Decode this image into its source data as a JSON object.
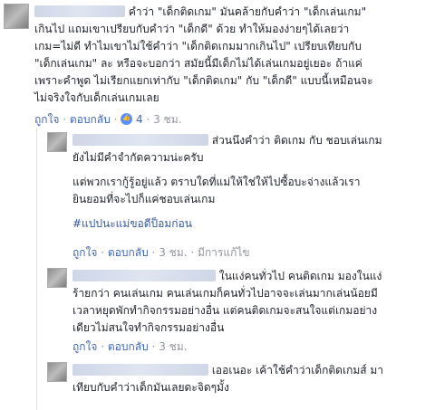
{
  "comment1": {
    "lines": [
      "คำว่า \"เด็กติดเกม\" มันคล้ายกับคำว่า \"เด็กเล่นเกม\"",
      "เกินไป แถมเขาเปรียบกับคำว่า \"เด็กดี\" ด้วย ทำให้มองง่ายๆได้เลยว่า",
      "เกม=ไม่ดี ทำไมเขาไม่ใช้คำว่า \"เด็กติดเกมมากเกินไป\" เปรียบเทียบกับ",
      "\"เด็กเล่นเกม\" ละ หรือจะบอกว่า สมัยนี้มีเด็กไม่ได้เล่นเกมอยู่เยอะ ถ้าแค่",
      "เพราะคำพูด ไม่เรียกแยกเท่ากับ \"เด็กติดเกม\" กับ \"เด็กดี\" แบบนี้เหมือนจะ",
      "ไม่จริงใจกับเด็กเล่นเกมเลย"
    ],
    "actions": {
      "like": "ถูกใจ",
      "reply": "ตอบกลับ",
      "like_count": "4",
      "time": "3 ชม."
    }
  },
  "reply1": {
    "lines": [
      "ส่วนนึงคำว่า ติดเกม กับ ชอบเล่นเกม",
      "ยังไม่มีคำจำกัดความน่ะครับ",
      "",
      "แต่พวกเรากู้รู้อยู่แล้ว ตราบใดที่แม่ให้ใช่ให้ไปซื้อบะจ่างแล้วเรา",
      "ยินยอมที่จะไปก็แค่ชอบเล่นเกม",
      "",
      "#แปปนะแม่ขอดีป็อมก่อน"
    ],
    "actions": {
      "like": "ถูกใจ",
      "reply": "ตอบกลับ",
      "time": "3 ชม.",
      "edited": "มีการแก้ไข"
    }
  },
  "reply2": {
    "lines": [
      "ในแง่คนทั่วไป คนติดเกม มองในแง่",
      "ร้ายกว่า คนเล่นเกม คนเล่นเกมก็คนทั่วไปอาจจะเล่นมากเล่นน้อยมี",
      "เวลาหยุดพักทำกิจกรรมอย่างอื่น แต่คนติดเกมจะสนใจแต่เกมอย่าง",
      "เดียวไม่สนใจทำกิจกรรมอย่างอื่น"
    ],
    "actions": {
      "like": "ถูกใจ",
      "reply": "ตอบกลับ",
      "time": "3 ชม."
    }
  },
  "reply3": {
    "lines": [
      "เออเนอะ เค้าใช้คำว่าเด็กติดเกมส์ มา",
      "เทียบกับคำว่าเด็กมันเลยดะจิดๆมั้ง"
    ]
  },
  "icons": {
    "like": "like-icon"
  },
  "colors": {
    "link": "#4267b2",
    "meta": "#90949c",
    "text": "#1d2129"
  }
}
